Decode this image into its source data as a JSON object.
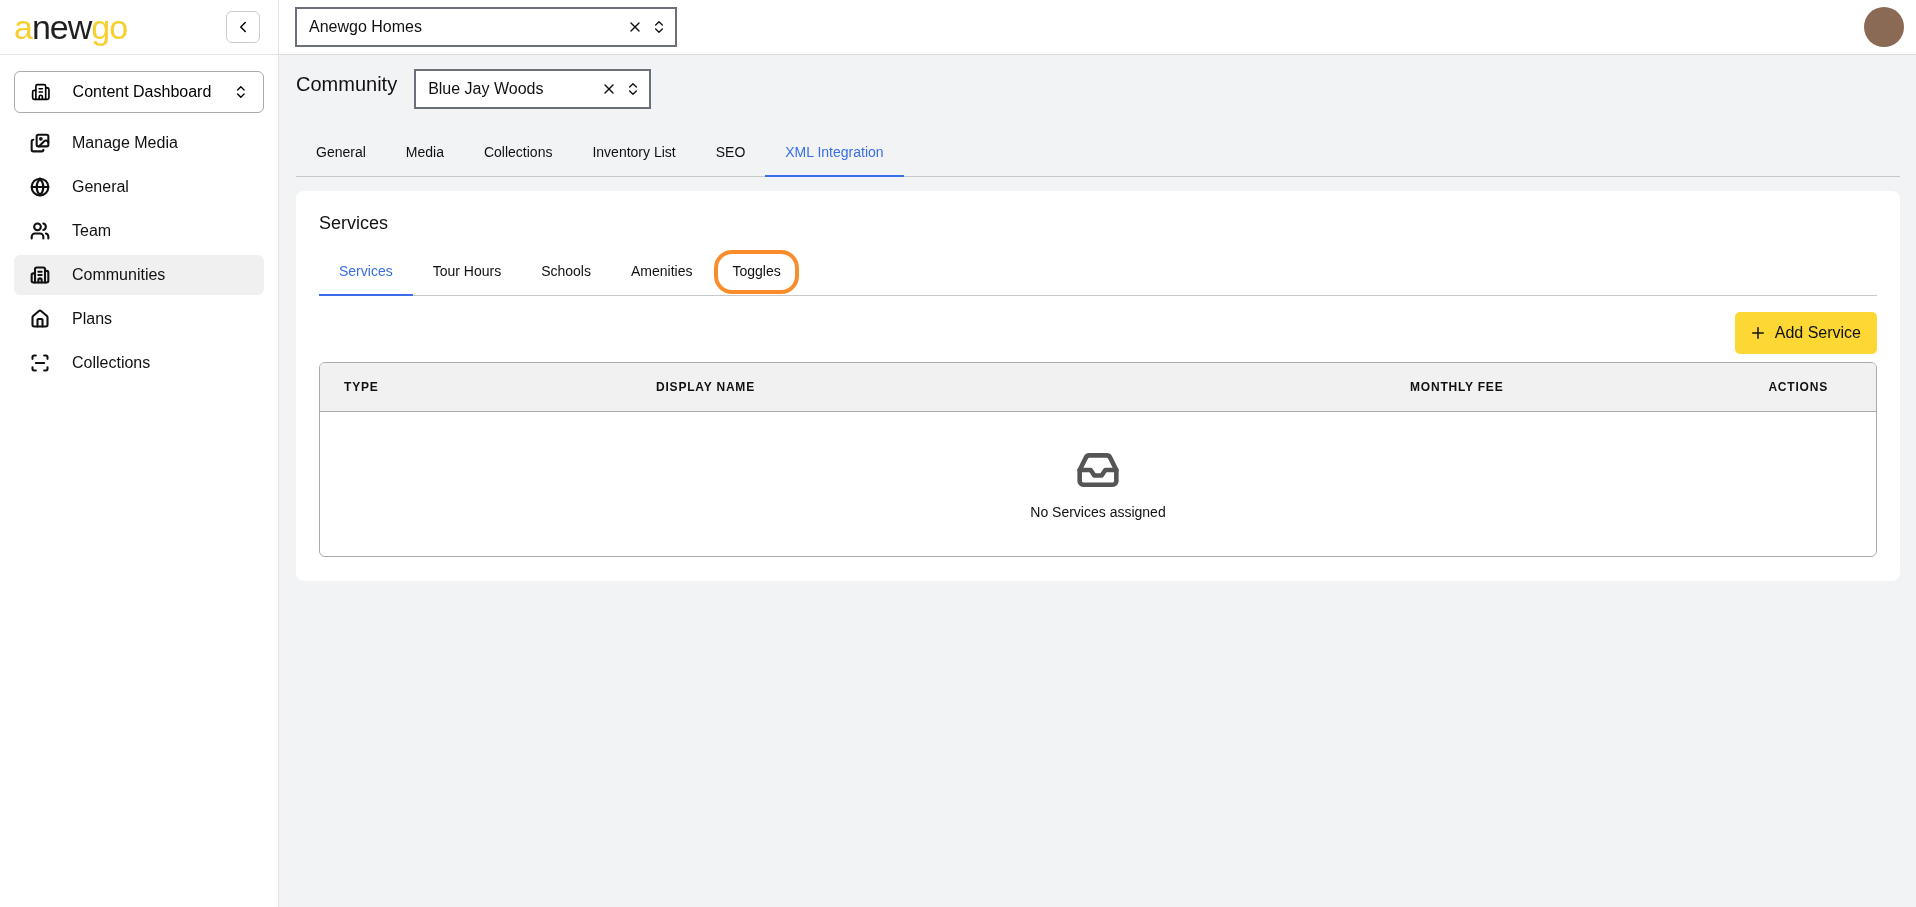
{
  "logo": [
    {
      "text": "a",
      "color": "#f7cf2c"
    },
    {
      "text": "new",
      "color": "#1f1f1f"
    },
    {
      "text": "go",
      "color": "#f7cf2c"
    }
  ],
  "workspace_select": {
    "value": "Content Dashboard"
  },
  "sidebar": {
    "items": [
      {
        "label": "Manage Media",
        "selected": false
      },
      {
        "label": "General",
        "selected": false
      },
      {
        "label": "Team",
        "selected": false
      },
      {
        "label": "Communities",
        "selected": true
      },
      {
        "label": "Plans",
        "selected": false
      },
      {
        "label": "Collections",
        "selected": false
      }
    ]
  },
  "company_select": {
    "value": "Anewgo Homes"
  },
  "community": {
    "title": "Community",
    "value": "Blue Jay Woods"
  },
  "tabs": [
    {
      "label": "General",
      "selected": false
    },
    {
      "label": "Media",
      "selected": false
    },
    {
      "label": "Collections",
      "selected": false
    },
    {
      "label": "Inventory List",
      "selected": false
    },
    {
      "label": "SEO",
      "selected": false
    },
    {
      "label": "XML Integration",
      "selected": true
    }
  ],
  "card": {
    "title": "Services",
    "tabs": [
      {
        "label": "Services",
        "selected": true,
        "highlighted": false
      },
      {
        "label": "Tour Hours",
        "selected": false,
        "highlighted": false
      },
      {
        "label": "Schools",
        "selected": false,
        "highlighted": false
      },
      {
        "label": "Amenities",
        "selected": false,
        "highlighted": false
      },
      {
        "label": "Toggles",
        "selected": false,
        "highlighted": true
      }
    ],
    "add_button": "Add Service",
    "table": {
      "columns": [
        "TYPE",
        "DISPLAY NAME",
        "MONTHLY FEE",
        "ACTIONS"
      ],
      "empty_text": "No Services assigned"
    }
  }
}
